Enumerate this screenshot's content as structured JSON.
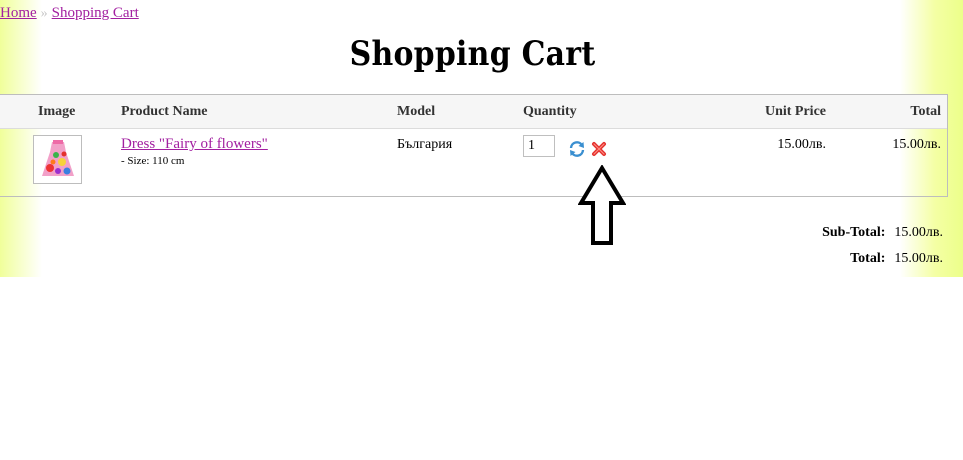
{
  "breadcrumb": {
    "home": "Home",
    "separator": "»",
    "current": "Shopping Cart"
  },
  "page_title": "Shopping Cart",
  "table": {
    "headers": {
      "image": "Image",
      "name": "Product Name",
      "model": "Model",
      "quantity": "Quantity",
      "unit_price": "Unit Price",
      "total": "Total"
    },
    "rows": [
      {
        "name": "Dress \"Fairy of flowers\"",
        "option": "- Size: 110 cm",
        "model": "България",
        "quantity": "1",
        "unit_price": "15.00лв.",
        "total": "15.00лв."
      }
    ]
  },
  "totals": {
    "subtotal_label": "Sub-Total:",
    "subtotal_value": "15.00лв.",
    "total_label": "Total:",
    "total_value": "15.00лв."
  },
  "icons": {
    "update": "refresh-icon",
    "remove": "remove-icon",
    "annotation": "up-arrow-icon"
  },
  "colors": {
    "link": "#a21fa0",
    "remove": "#e3312d",
    "update": "#3a8fd0",
    "band": "#f0ff9a"
  }
}
